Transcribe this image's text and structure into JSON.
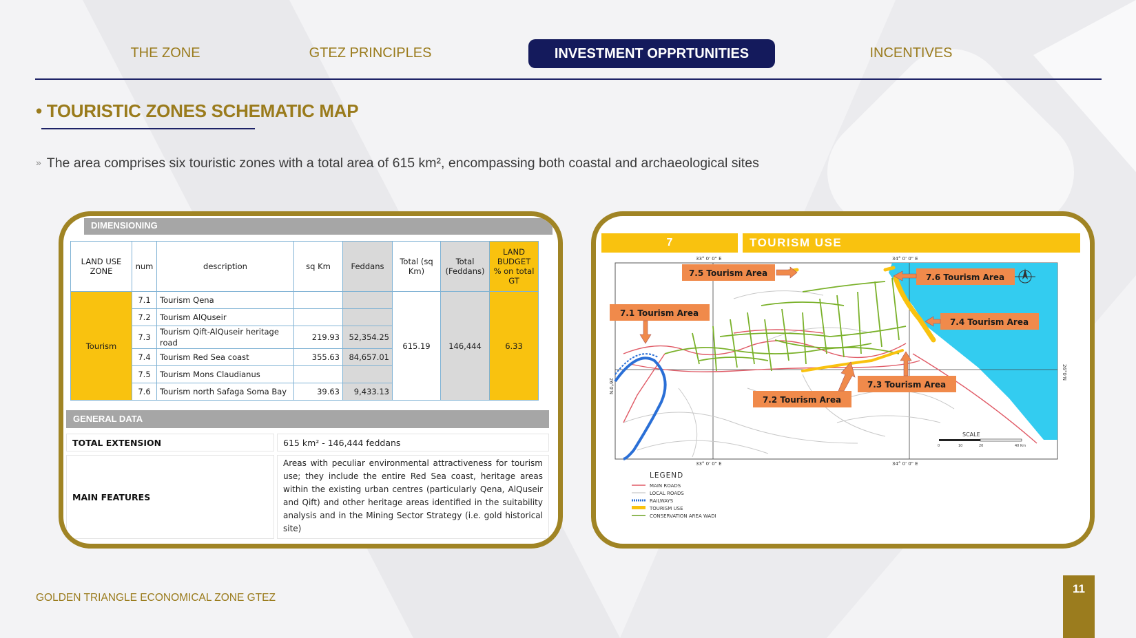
{
  "nav": {
    "items": [
      {
        "label": "THE ZONE"
      },
      {
        "label": "GTEZ PRINCIPLES"
      },
      {
        "label": "INVESTMENT OPPRTUNITIES"
      },
      {
        "label": "INCENTIVES"
      }
    ],
    "active_index": 2
  },
  "slide": {
    "title": "• TOURISTIC ZONES SCHEMATIC MAP",
    "subtitle_bullet": "»",
    "subtitle": "The area comprises six touristic zones with a total area of 615 km², encompassing both coastal and archaeological sites"
  },
  "dimension_table": {
    "section_label": "DIMENSIONING",
    "headers": {
      "zone": "LAND USE ZONE",
      "num": "num",
      "description": "description",
      "sqkm": "sq Km",
      "feddans": "Feddans",
      "total_sqkm": "Total (sq Km)",
      "total_feddans": "Total (Feddans)",
      "budget": "LAND BUDGET % on total GT"
    },
    "zone": "Tourism",
    "rows": [
      {
        "num": "7.1",
        "description": "Tourism Qena",
        "sqkm": "",
        "feddans": ""
      },
      {
        "num": "7.2",
        "description": "Tourism AlQuseir",
        "sqkm": "",
        "feddans": ""
      },
      {
        "num": "7.3",
        "description": "Tourism Qift-AlQuseir heritage road",
        "sqkm": "219.93",
        "feddans": "52,354.25"
      },
      {
        "num": "7.4",
        "description": "Tourism Red Sea coast",
        "sqkm": "355.63",
        "feddans": "84,657.01"
      },
      {
        "num": "7.5",
        "description": "Tourism Mons Claudianus",
        "sqkm": "",
        "feddans": ""
      },
      {
        "num": "7.6",
        "description": "Tourism north Safaga Soma Bay",
        "sqkm": "39.63",
        "feddans": "9,433.13"
      }
    ],
    "total_sqkm": "615.19",
    "total_feddans": "146,444",
    "budget": "6.33"
  },
  "general_data": {
    "section_label": "GENERAL DATA",
    "total_extension_label": "TOTAL EXTENSION",
    "total_extension_value": "615 km² - 146,444 feddans",
    "main_features_label": "MAIN FEATURES",
    "main_features_value": "Areas with peculiar environmental attractiveness for tourism use; they include the entire Red Sea coast, heritage areas within the existing urban centres (particularly Qena, AlQuseir and Qift) and other heritage areas identified in the suitability analysis and in the Mining Sector Strategy (i.e. gold historical site)"
  },
  "map": {
    "header_num": "7",
    "header_title": "TOURISM USE",
    "areas": [
      {
        "label": "7.1 Tourism Area"
      },
      {
        "label": "7.2 Tourism Area"
      },
      {
        "label": "7.3 Tourism Area"
      },
      {
        "label": "7.4 Tourism Area"
      },
      {
        "label": "7.5 Tourism Area"
      },
      {
        "label": "7.6 Tourism Area"
      }
    ],
    "coords": {
      "top_left": "33° 0' 0\" E",
      "top_right": "34° 0' 0\" E",
      "bottom_left": "33° 0' 0\" E",
      "bottom_right": "34° 0' 0\" E",
      "left_lat": "26°0'N",
      "right_lat": "26°0'N"
    },
    "scale_label": "SCALE",
    "scale_ticks": [
      "0",
      "10",
      "20",
      "40 Km"
    ],
    "legend": {
      "title": "LEGEND",
      "items": [
        {
          "label": "MAIN ROADS",
          "color": "#d9534f"
        },
        {
          "label": "LOCAL ROADS",
          "color": "#bbbbbb"
        },
        {
          "label": "RAILWAYS",
          "color": "#2a6fd6"
        },
        {
          "label": "TOURISM USE",
          "color": "#f9c20f"
        },
        {
          "label": "CONSERVATION AREA WADI",
          "color": "#6aa121"
        }
      ]
    },
    "colors": {
      "sea": "#33ccf0",
      "callout": "#f08a4b",
      "tourism": "#f9c20f",
      "wadi": "#7ab12a",
      "road": "#e05a66"
    }
  },
  "footer": {
    "text": "GOLDEN TRIANGLE ECONOMICAL ZONE GTEZ",
    "page_number": "11"
  },
  "theme": {
    "gold": "#9a7b1c",
    "navy": "#141a5c"
  }
}
